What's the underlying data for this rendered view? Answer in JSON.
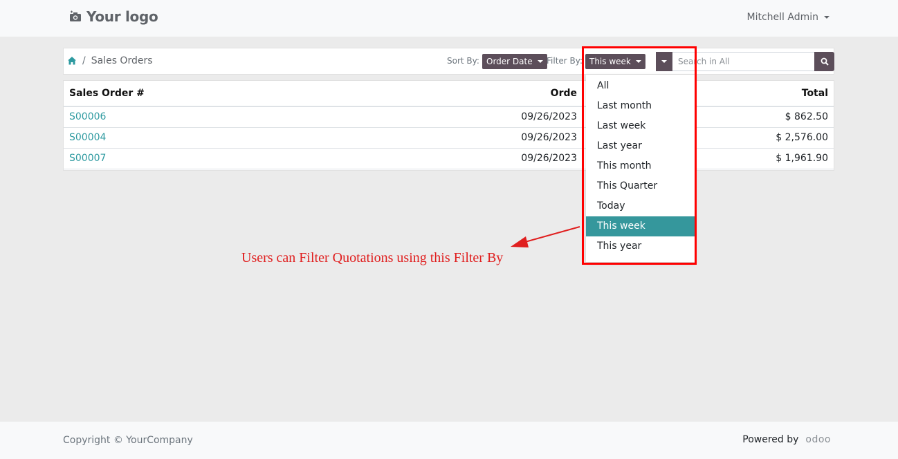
{
  "header": {
    "logo_text": "Your logo",
    "user_name": "Mitchell Admin"
  },
  "breadcrumb": {
    "current": "Sales Orders",
    "separator": "/"
  },
  "toolbar": {
    "sort_label": "Sort By:",
    "sort_value": "Order Date",
    "filter_label": "Filter By:",
    "filter_value": "This week",
    "search_placeholder": "Search in All"
  },
  "table": {
    "columns": [
      "Sales Order #",
      "Orde",
      "Total"
    ],
    "rows": [
      {
        "order": "S00006",
        "date": "09/26/2023",
        "total": "$ 862.50"
      },
      {
        "order": "S00004",
        "date": "09/26/2023",
        "total": "$ 2,576.00"
      },
      {
        "order": "S00007",
        "date": "09/26/2023",
        "total": "$ 1,961.90"
      }
    ]
  },
  "filter_dropdown": {
    "options": [
      "All",
      "Last month",
      "Last week",
      "Last year",
      "This month",
      "This Quarter",
      "Today",
      "This week",
      "This year"
    ],
    "selected": "This week"
  },
  "annotation": {
    "text": "Users can Filter Quotations using this Filter By",
    "color": "#e01f1f"
  },
  "footer": {
    "copyright": "Copyright © YourCompany",
    "powered_by": "Powered by",
    "brand": "odoo"
  },
  "colors": {
    "accent": "#35979c",
    "button": "#5c4e5a",
    "highlight": "#ff0000"
  }
}
